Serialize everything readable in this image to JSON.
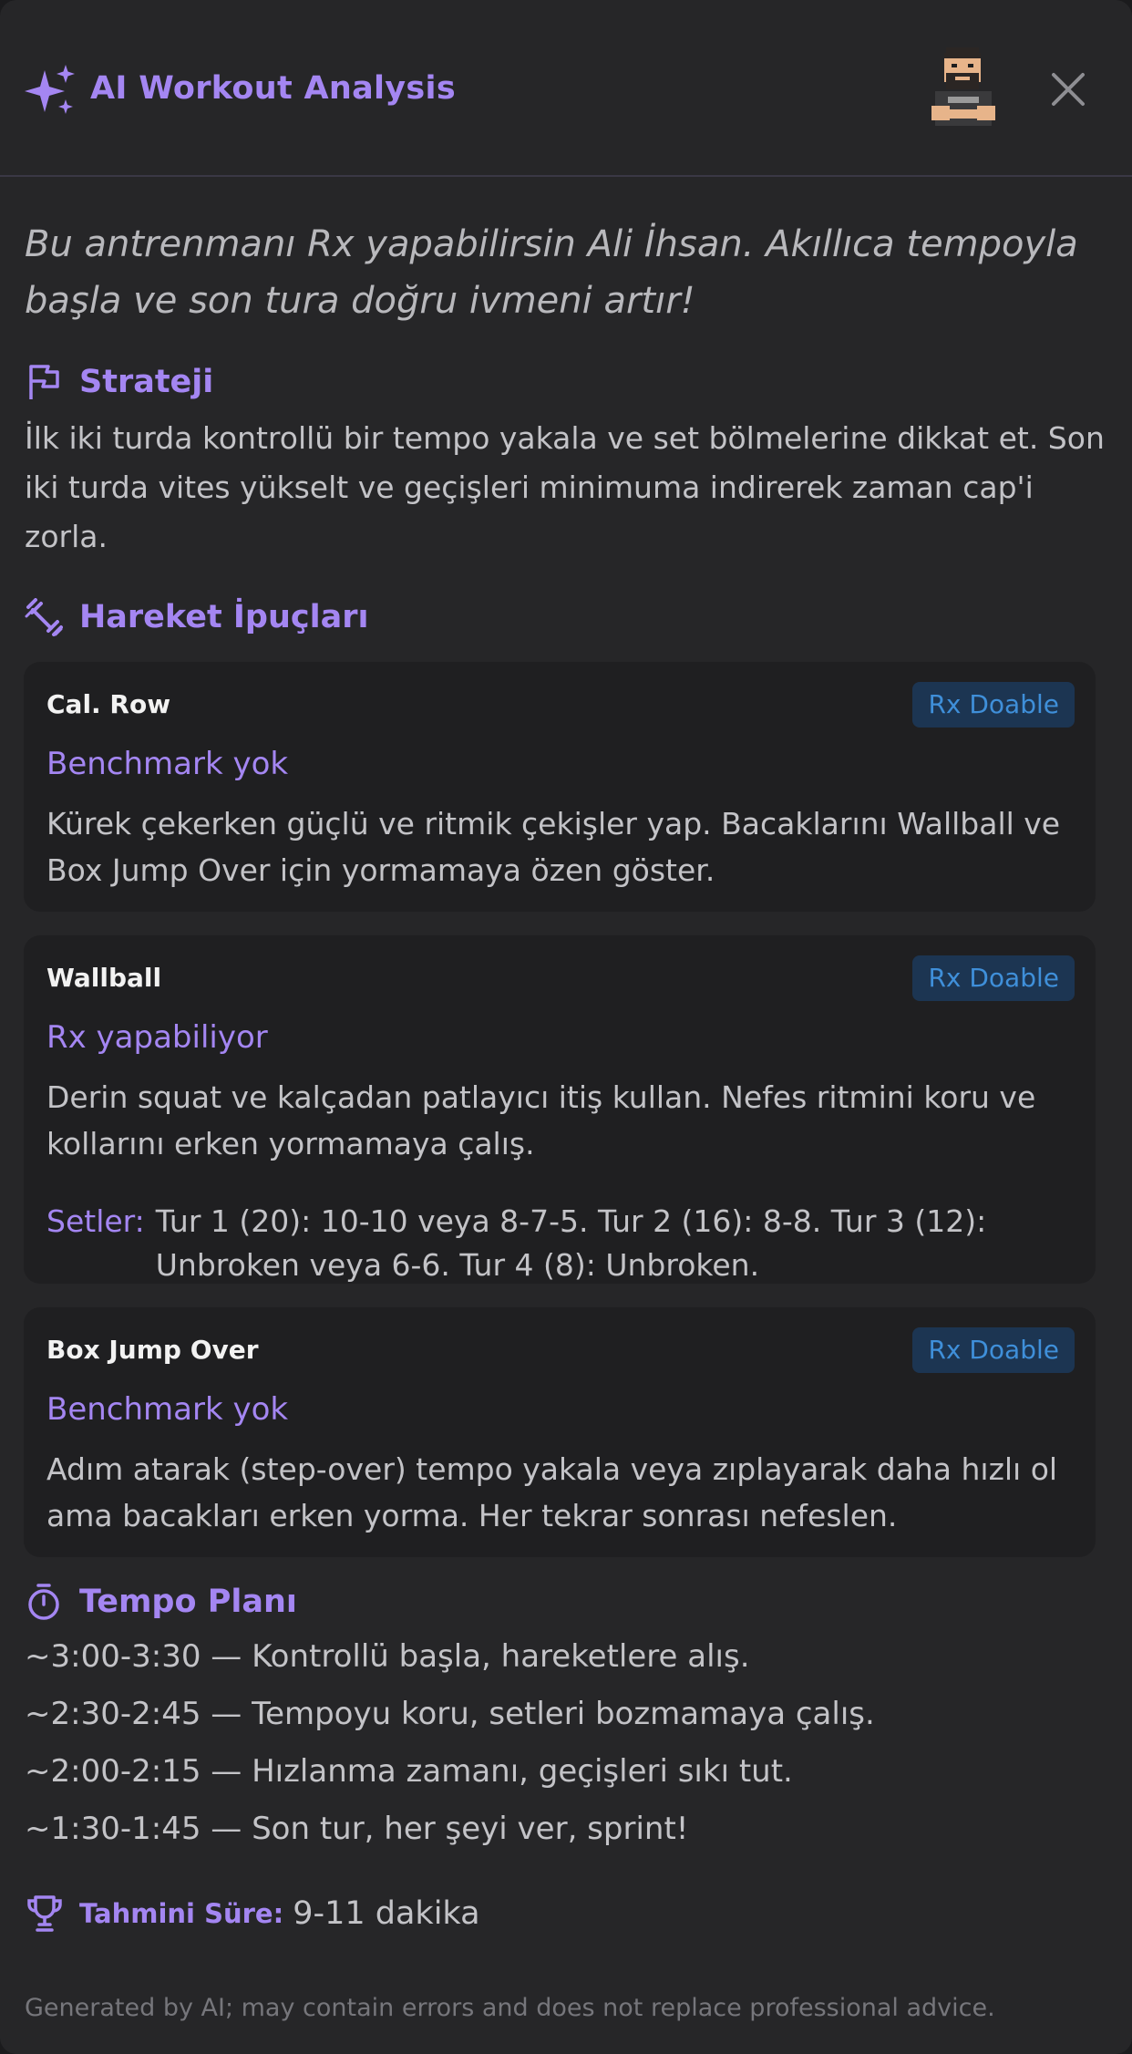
{
  "header": {
    "title": "AI Workout Analysis",
    "icon": "sparkles-icon",
    "avatar": "crossfit-avatar",
    "close_icon": "close-icon"
  },
  "intro": "Bu antrenmanı Rx yapabilirsin Ali İhsan. Akıllıca tempoyla başla ve son tura doğru ivmeni artır!",
  "strategy": {
    "title": "Strateji",
    "icon": "flag-icon",
    "text": "İlk iki turda kontrollü bir tempo yakala ve set bölmelerine dikkat et. Son iki turda vites yükselt ve geçişleri minimuma indirerek zaman cap'i zorla."
  },
  "tips": {
    "title": "Hareket İpuçları",
    "icon": "dumbbell-icon",
    "cards": [
      {
        "name": "Cal. Row",
        "badge": "Rx Doable",
        "status": "Benchmark yok",
        "desc": "Kürek çekerken güçlü ve ritmik çekişler yap. Bacaklarını Wallball ve Box Jump Over için yormamaya özen göster."
      },
      {
        "name": "Wallball",
        "badge": "Rx Doable",
        "status": "Rx yapabiliyor",
        "desc": "Derin squat ve kalçadan patlayıcı itiş kullan. Nefes ritmini koru ve kollarını erken yormamaya çalış.",
        "sets_label": "Setler:",
        "sets": "Tur 1 (20): 10-10 veya 8-7-5. Tur 2 (16): 8-8. Tur 3 (12): Unbroken veya 6-6. Tur 4 (8): Unbroken."
      },
      {
        "name": "Box Jump Over",
        "badge": "Rx Doable",
        "status": "Benchmark yok",
        "desc": "Adım atarak (step-over) tempo yakala veya zıplayarak daha hızlı ol ama bacakları erken yorma. Her tekrar sonrası nefeslen."
      }
    ]
  },
  "tempo": {
    "title": "Tempo Planı",
    "icon": "stopwatch-icon",
    "lines": [
      "~3:00-3:30 — Kontrollü başla, hareketlere alış.",
      "~2:30-2:45 — Tempoyu koru, setleri bozmamaya çalış.",
      "~2:00-2:15 — Hızlanma zamanı, geçişleri sıkı tut.",
      "~1:30-1:45 — Son tur, her şeyi ver, sprint!"
    ]
  },
  "estimate": {
    "icon": "trophy-icon",
    "label": "Tahmini Süre:",
    "value": "9-11 dakika"
  },
  "footer": "Generated by AI; may contain errors and does not replace professional advice.",
  "colors": {
    "accent": "#a486f2",
    "badge_bg": "#1c3552",
    "badge_text": "#3f8fd9",
    "background": "#262628",
    "card": "#1f1f21"
  }
}
